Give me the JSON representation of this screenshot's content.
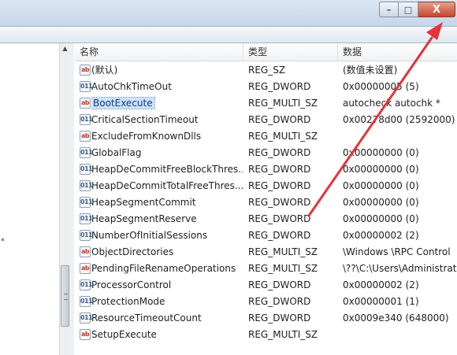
{
  "window": {
    "minimize_glyph": "–",
    "maximize_glyph": "□",
    "close_glyph": "X"
  },
  "columns": {
    "name": "名称",
    "type": "类型",
    "data": "数据"
  },
  "rows": [
    {
      "icon": "ab",
      "name": "(默认)",
      "type": "REG_SZ",
      "data": "(数值未设置)"
    },
    {
      "icon": "bin",
      "name": "AutoChkTimeOut",
      "type": "REG_DWORD",
      "data": "0x00000005 (5)"
    },
    {
      "icon": "ab",
      "name": "BootExecute",
      "type": "REG_MULTI_SZ",
      "data": "autocheck autochk *",
      "selected": true
    },
    {
      "icon": "bin",
      "name": "CriticalSectionTimeout",
      "type": "REG_DWORD",
      "data": "0x00278d00 (2592000)"
    },
    {
      "icon": "ab",
      "name": "ExcludeFromKnownDlls",
      "type": "REG_MULTI_SZ",
      "data": ""
    },
    {
      "icon": "bin",
      "name": "GlobalFlag",
      "type": "REG_DWORD",
      "data": "0x00000000 (0)"
    },
    {
      "icon": "bin",
      "name": "HeapDeCommitFreeBlockThres...",
      "type": "REG_DWORD",
      "data": "0x00000000 (0)"
    },
    {
      "icon": "bin",
      "name": "HeapDeCommitTotalFreeThres...",
      "type": "REG_DWORD",
      "data": "0x00000000 (0)"
    },
    {
      "icon": "bin",
      "name": "HeapSegmentCommit",
      "type": "REG_DWORD",
      "data": "0x00000000 (0)"
    },
    {
      "icon": "bin",
      "name": "HeapSegmentReserve",
      "type": "REG_DWORD",
      "data": "0x00000000 (0)"
    },
    {
      "icon": "bin",
      "name": "NumberOfInitialSessions",
      "type": "REG_DWORD",
      "data": "0x00000002 (2)"
    },
    {
      "icon": "ab",
      "name": "ObjectDirectories",
      "type": "REG_MULTI_SZ",
      "data": "\\Windows \\RPC Control"
    },
    {
      "icon": "ab",
      "name": "PendingFileRenameOperations",
      "type": "REG_MULTI_SZ",
      "data": "\\??\\C:\\Users\\Administrato"
    },
    {
      "icon": "bin",
      "name": "ProcessorControl",
      "type": "REG_DWORD",
      "data": "0x00000002 (2)"
    },
    {
      "icon": "bin",
      "name": "ProtectionMode",
      "type": "REG_DWORD",
      "data": "0x00000001 (1)"
    },
    {
      "icon": "bin",
      "name": "ResourceTimeoutCount",
      "type": "REG_DWORD",
      "data": "0x0009e340 (648000)"
    },
    {
      "icon": "ab",
      "name": "SetupExecute",
      "type": "REG_MULTI_SZ",
      "data": ""
    }
  ],
  "icon_glyphs": {
    "ab": "ab",
    "bin": "011"
  },
  "colors": {
    "annotation": "#e5333a",
    "selection": "#cfe2f8"
  }
}
